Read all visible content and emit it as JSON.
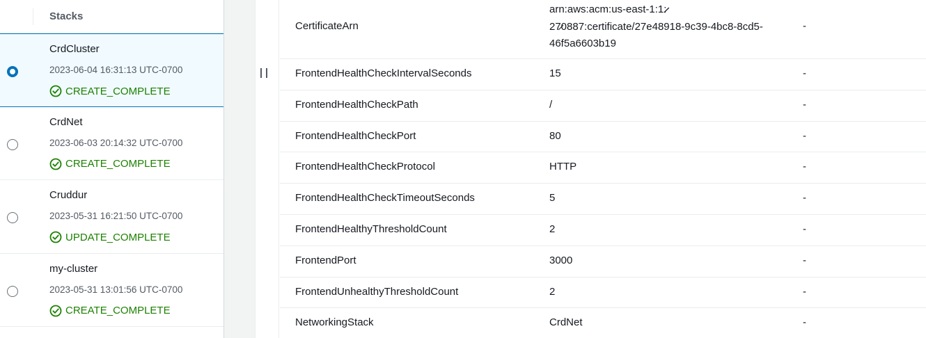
{
  "stacks": {
    "header": "Stacks",
    "items": [
      {
        "name": "CrdCluster",
        "date": "2023-06-04 16:31:13 UTC-0700",
        "status": "CREATE_COMPLETE",
        "selected": true
      },
      {
        "name": "CrdNet",
        "date": "2023-06-03 20:14:32 UTC-0700",
        "status": "CREATE_COMPLETE",
        "selected": false
      },
      {
        "name": "Cruddur",
        "date": "2023-05-31 16:21:50 UTC-0700",
        "status": "UPDATE_COMPLETE",
        "selected": false
      },
      {
        "name": "my-cluster",
        "date": "2023-05-31 13:01:56 UTC-0700",
        "status": "CREATE_COMPLETE",
        "selected": false
      }
    ]
  },
  "parameters": {
    "rows": [
      {
        "key": "CertificateArn",
        "value": "arn:aws:acm:us-east-1:1:̷̷̷  27̷0887:certificate/27e48918-9c39-4bc8-8cd5-46f5a6603b19",
        "resolved": "-"
      },
      {
        "key": "FrontendHealthCheckIntervalSeconds",
        "value": "15",
        "resolved": "-"
      },
      {
        "key": "FrontendHealthCheckPath",
        "value": "/",
        "resolved": "-"
      },
      {
        "key": "FrontendHealthCheckPort",
        "value": "80",
        "resolved": "-"
      },
      {
        "key": "FrontendHealthCheckProtocol",
        "value": "HTTP",
        "resolved": "-"
      },
      {
        "key": "FrontendHealthCheckTimeoutSeconds",
        "value": "5",
        "resolved": "-"
      },
      {
        "key": "FrontendHealthyThresholdCount",
        "value": "2",
        "resolved": "-"
      },
      {
        "key": "FrontendPort",
        "value": "3000",
        "resolved": "-"
      },
      {
        "key": "FrontendUnhealthyThresholdCount",
        "value": "2",
        "resolved": "-"
      },
      {
        "key": "NetworkingStack",
        "value": "CrdNet",
        "resolved": "-"
      }
    ]
  },
  "colors": {
    "accent": "#0073bb",
    "success": "#1d8102",
    "selected_bg": "#f1faff"
  },
  "icons": {
    "status": "check-circle-icon",
    "splitter": "drag-handle-icon"
  }
}
